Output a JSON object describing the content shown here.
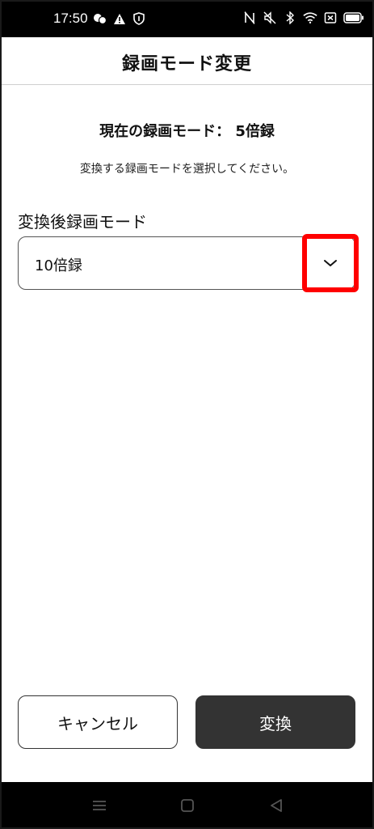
{
  "status_bar": {
    "time": "17:50",
    "left_icons": [
      "chat-bubbles-icon",
      "warning-icon",
      "shield-icon"
    ],
    "right_icons": [
      "nfc-icon",
      "mute-icon",
      "bluetooth-icon",
      "wifi-icon",
      "sim-off-icon",
      "battery-icon"
    ]
  },
  "header": {
    "title": "録画モード変更"
  },
  "current": {
    "text": "現在の録画モード： 5倍録"
  },
  "instruction": "変換する録画モードを選択してください。",
  "field": {
    "label": "変換後録画モード",
    "selected_value": "10倍録"
  },
  "buttons": {
    "cancel": "キャンセル",
    "convert": "変換"
  },
  "nav": {
    "items": [
      "menu-icon",
      "home-icon",
      "back-icon"
    ]
  },
  "colors": {
    "highlight": "#ff0000",
    "primary_button": "#333333"
  }
}
